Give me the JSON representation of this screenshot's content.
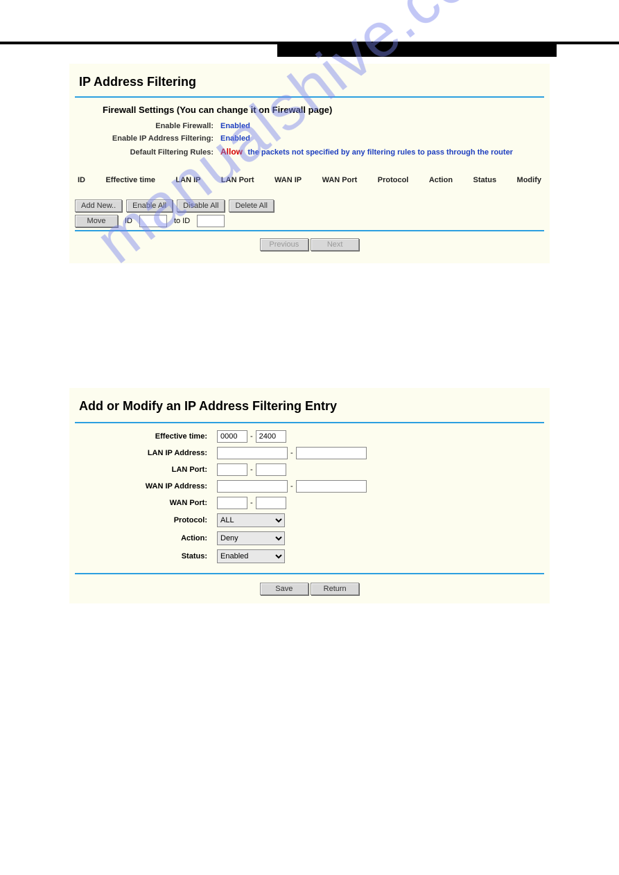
{
  "colors": {
    "accent": "#2c9fe0",
    "link": "#1e3fbf",
    "allow": "#d40000"
  },
  "page1": {
    "title": "IP Address Filtering",
    "subhead": "Firewall Settings (You can change it on Firewall page)",
    "settings": {
      "enable_firewall_label": "Enable Firewall:",
      "enable_firewall_value": "Enabled",
      "enable_ipfilter_label": "Enable IP Address Filtering:",
      "enable_ipfilter_value": "Enabled",
      "default_rules_label": "Default Filtering Rules:",
      "default_rules_allow": "Allow",
      "default_rules_text": "the packets not specified by any filtering rules to pass through the router"
    },
    "columns": [
      "ID",
      "Effective time",
      "LAN IP",
      "LAN Port",
      "WAN IP",
      "WAN Port",
      "Protocol",
      "Action",
      "Status",
      "Modify"
    ],
    "buttons": {
      "add_new": "Add New..",
      "enable_all": "Enable All",
      "disable_all": "Disable All",
      "delete_all": "Delete All",
      "move": "Move",
      "id_label": "ID",
      "to_id_label": "to ID",
      "previous": "Previous",
      "next": "Next",
      "id_value": "",
      "to_id_value": ""
    }
  },
  "page2": {
    "title": "Add or Modify an IP Address Filtering Entry",
    "labels": {
      "effective_time": "Effective time:",
      "lan_ip": "LAN IP Address:",
      "lan_port": "LAN Port:",
      "wan_ip": "WAN IP Address:",
      "wan_port": "WAN Port:",
      "protocol": "Protocol:",
      "action": "Action:",
      "status": "Status:"
    },
    "values": {
      "time_from": "0000",
      "time_to": "2400",
      "lan_ip_from": "",
      "lan_ip_to": "",
      "lan_port_from": "",
      "lan_port_to": "",
      "wan_ip_from": "",
      "wan_ip_to": "",
      "wan_port_from": "",
      "wan_port_to": "",
      "protocol": "ALL",
      "action": "Deny",
      "status": "Enabled"
    },
    "buttons": {
      "save": "Save",
      "return": "Return"
    },
    "dash": "-"
  },
  "watermark": "manualshive.com"
}
